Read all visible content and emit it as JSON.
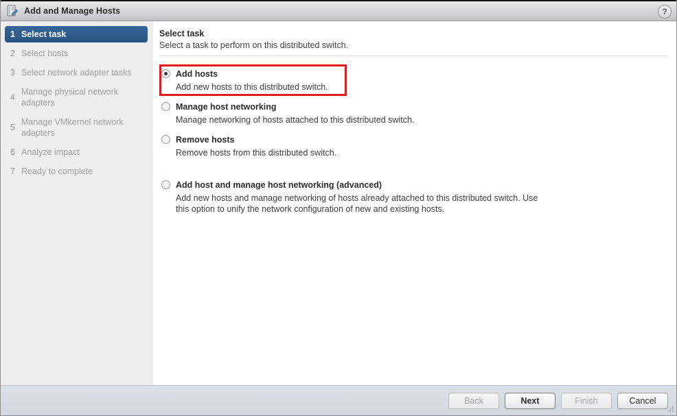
{
  "window": {
    "title": "Add and Manage Hosts",
    "icon": "manage-hosts-icon",
    "help_label": "?"
  },
  "sidebar": {
    "steps": [
      {
        "num": "1",
        "label": "Select task",
        "active": true
      },
      {
        "num": "2",
        "label": "Select hosts",
        "active": false
      },
      {
        "num": "3",
        "label": "Select network adapter tasks",
        "active": false
      },
      {
        "num": "4",
        "label": "Manage physical network adapters",
        "active": false
      },
      {
        "num": "5",
        "label": "Manage VMkernel network adapters",
        "active": false
      },
      {
        "num": "6",
        "label": "Analyze impact",
        "active": false
      },
      {
        "num": "7",
        "label": "Ready to complete",
        "active": false
      }
    ]
  },
  "main": {
    "title": "Select task",
    "subtitle": "Select a task to perform on this distributed switch.",
    "options": [
      {
        "label": "Add hosts",
        "description": "Add new hosts to this distributed switch.",
        "selected": true,
        "highlighted": true
      },
      {
        "label": "Manage host networking",
        "description": "Manage networking of hosts attached to this distributed switch.",
        "selected": false,
        "highlighted": false
      },
      {
        "label": "Remove hosts",
        "description": "Remove hosts from this distributed switch.",
        "selected": false,
        "highlighted": false
      },
      {
        "label": "Add host and manage host networking (advanced)",
        "description": "Add new hosts and manage networking of hosts already attached to this distributed switch. Use this option to unify the network configuration of new and existing hosts.",
        "selected": false,
        "highlighted": false
      }
    ]
  },
  "footer": {
    "back_label": "Back",
    "next_label": "Next",
    "finish_label": "Finish",
    "cancel_label": "Cancel"
  },
  "colors": {
    "accent_blue": "#2a5580",
    "highlight_red": "#e01b1b",
    "sidebar_bg": "#eeeeee",
    "footer_bg": "#d8dce3"
  }
}
